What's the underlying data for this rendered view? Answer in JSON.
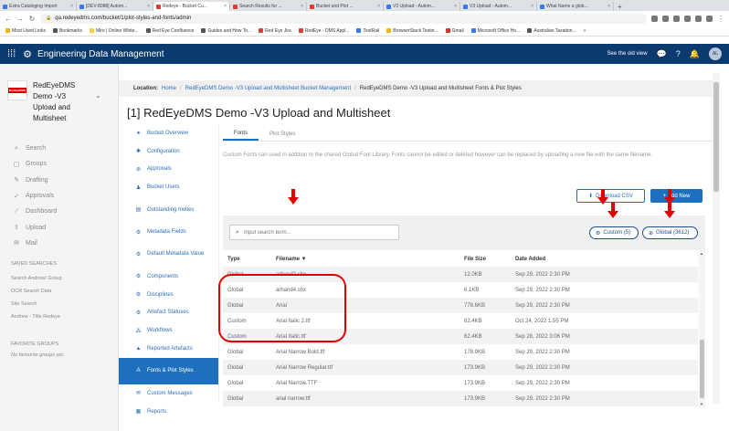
{
  "browser": {
    "tabs": [
      {
        "title": "Extra Cataloging Import",
        "color": "#3b78e7",
        "active": false
      },
      {
        "title": "[DEV-8088] Autom...",
        "color": "#3b78e7",
        "active": false
      },
      {
        "title": "Redeye - Bucket Cu...",
        "color": "#e53935",
        "active": true
      },
      {
        "title": "Search Results for ...",
        "color": "#e53935",
        "active": false
      },
      {
        "title": "Bucket and Plot ...",
        "color": "#e53935",
        "active": false
      },
      {
        "title": "V3 Upload - Autom...",
        "color": "#3b78e7",
        "active": false
      },
      {
        "title": "V3 Upload - Autom...",
        "color": "#3b78e7",
        "active": false
      },
      {
        "title": "What Name a glob...",
        "color": "#3b78e7",
        "active": false
      }
    ],
    "new_tab": "+",
    "url": "qa.redeyedms.com/bucket/1/plot-styles-and-fonts/admin",
    "bookmarks": [
      {
        "label": "Most Used Links",
        "color": "#f4b400"
      },
      {
        "label": "Bookmarks",
        "color": "#555555"
      },
      {
        "label": "Miro | Online White...",
        "color": "#f4d03f"
      },
      {
        "label": "Red Eye Confluence",
        "color": "#555555"
      },
      {
        "label": "Guides and How To...",
        "color": "#555555"
      },
      {
        "label": "Red Eye Jira",
        "color": "#e53935"
      },
      {
        "label": "RedEye - DMS Appl...",
        "color": "#e53935"
      },
      {
        "label": "TestRail",
        "color": "#3b78e7"
      },
      {
        "label": "BrowserStack Testin...",
        "color": "#f4b400"
      },
      {
        "label": "Gmail",
        "color": "#d93025"
      },
      {
        "label": "Microsoft Office Ho...",
        "color": "#3b78e7"
      },
      {
        "label": "Australian Taxation...",
        "color": "#555555"
      }
    ],
    "more": "»"
  },
  "app": {
    "title": "Engineering Data Management",
    "old_view": "See the old view",
    "avatar": "AL"
  },
  "project": {
    "logo_text": "RedEyeDMS",
    "name": "RedEyeDMS Demo -V3 Upload and Multisheet"
  },
  "main_nav": [
    {
      "icon": "⌕",
      "label": "Search"
    },
    {
      "icon": "▢",
      "label": "Groups"
    },
    {
      "icon": "✎",
      "label": "Drafting"
    },
    {
      "icon": "✓",
      "label": "Approvals"
    },
    {
      "icon": "⟋",
      "label": "Dashboard"
    },
    {
      "icon": "⇪",
      "label": "Upload"
    },
    {
      "icon": "✉",
      "label": "Mail"
    }
  ],
  "saved_searches": {
    "heading": "SAVED SEARCHES",
    "items": [
      "Search Andrew! Group",
      "OCR Search Data",
      "Site Search",
      "Andrew - Title Redeye"
    ]
  },
  "favourite_groups": {
    "heading": "FAVORITE GROUPS",
    "empty": "No favourite groups yet."
  },
  "breadcrumb": {
    "prefix": "Location:",
    "items": [
      "Home",
      "RedEyeDMS Demo -V3 Upload and Multisheet Bucket Management",
      "RedEyeDMS Demo -V3 Upload and Multisheet Fonts & Plot Styles"
    ],
    "sep": "/"
  },
  "page_title": "[1] RedEyeDMS Demo -V3 Upload and Multisheet",
  "bucket_nav": [
    {
      "icon": "●",
      "label": "Bucket Overview"
    },
    {
      "icon": "✱",
      "label": "Configuration"
    },
    {
      "icon": "⊛",
      "label": "Approvals"
    },
    {
      "icon": "♟",
      "label": "Bucket Users"
    },
    {
      "icon": "▤",
      "label": "Outstanding Invites"
    },
    {
      "icon": "⚙",
      "label": "Metadata Fields"
    },
    {
      "icon": "⚙",
      "label": "Default Metadata Value"
    },
    {
      "icon": "⚙",
      "label": "Components"
    },
    {
      "icon": "⚙",
      "label": "Disciplines"
    },
    {
      "icon": "⚙",
      "label": "Artefact Statuses"
    },
    {
      "icon": "⁂",
      "label": "Workflows"
    },
    {
      "icon": "▲",
      "label": "Reported Artefacts"
    },
    {
      "icon": "A",
      "label": "Fonts & Plot Styles"
    },
    {
      "icon": "✉",
      "label": "Custom Messages"
    },
    {
      "icon": "▦",
      "label": "Reports"
    }
  ],
  "tabs": [
    "Fonts",
    "Plot Styles"
  ],
  "description": "Custom Fonts can used in addition to the shared Global Font Library. Fonts cannot be edited or deleted however can be replaced by uploading a new file with the same filename.",
  "buttons": {
    "download_csv": "Download CSV",
    "add_new": "Add New",
    "download_icon": "⬇",
    "add_icon": "+"
  },
  "search": {
    "placeholder": "Input search term..."
  },
  "filters": {
    "custom": "Custom (5)",
    "global": "Global (3612)"
  },
  "table": {
    "headers": {
      "type": "Type",
      "filename": "Filename ▼",
      "size": "File Size",
      "date": "Date Added"
    },
    "rows": [
      {
        "type": "Global",
        "filename": "arhand2.shx",
        "size": "12.0KB",
        "date": "Sep 29, 2022 2:30 PM"
      },
      {
        "type": "Global",
        "filename": "arhand4.shx",
        "size": "6.1KB",
        "date": "Sep 29, 2022 2:30 PM"
      },
      {
        "type": "Global",
        "filename": "Arial",
        "size": "778.6KB",
        "date": "Sep 29, 2022 2:30 PM"
      },
      {
        "type": "Custom",
        "filename": "Arial Italic 2.ttf",
        "size": "62.4KB",
        "date": "Oct 24, 2022 1:55 PM"
      },
      {
        "type": "Custom",
        "filename": "Arial Italic.ttf",
        "size": "62.4KB",
        "date": "Sep 28, 2022 3:06 PM"
      },
      {
        "type": "Global",
        "filename": "Arial Narrow Bold.ttf",
        "size": "178.9KB",
        "date": "Sep 29, 2022 2:30 PM"
      },
      {
        "type": "Global",
        "filename": "Arial Narrow Regular.ttf",
        "size": "173.9KB",
        "date": "Sep 29, 2022 2:30 PM"
      },
      {
        "type": "Global",
        "filename": "Arial Narrow.TTF",
        "size": "173.9KB",
        "date": "Sep 29, 2022 2:30 PM"
      },
      {
        "type": "Global",
        "filename": "arial narrow.ttf",
        "size": "173.9KB",
        "date": "Sep 29, 2022 2:30 PM"
      }
    ]
  },
  "colors": {
    "brand": "#0a3a6f",
    "accent": "#1f6fbf",
    "annotation": "#e00000"
  }
}
